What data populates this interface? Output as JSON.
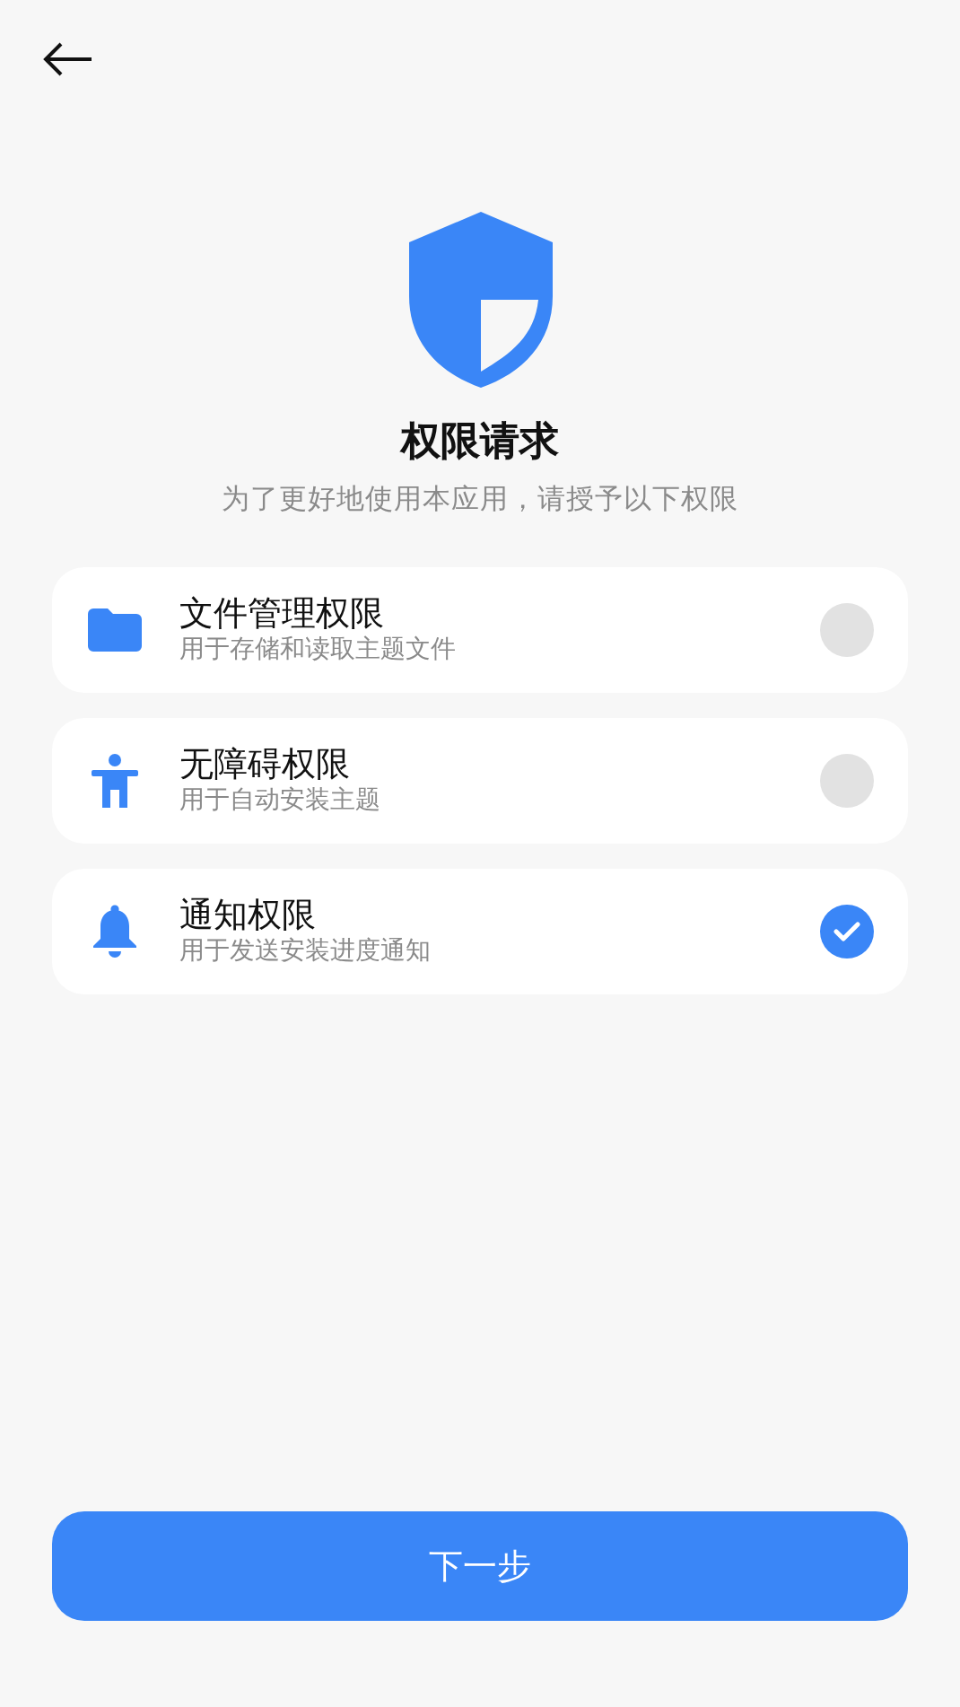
{
  "title": "权限请求",
  "subtitle": "为了更好地使用本应用，请授予以下权限",
  "permissions": [
    {
      "kind": "folder",
      "name": "文件管理权限",
      "description": "用于存储和读取主题文件",
      "checked": false
    },
    {
      "kind": "accessibility",
      "name": "无障碍权限",
      "description": "用于自动安装主题",
      "checked": false
    },
    {
      "kind": "bell",
      "name": "通知权限",
      "description": "用于发送安装进度通知",
      "checked": true
    }
  ],
  "next_button": "下一步"
}
